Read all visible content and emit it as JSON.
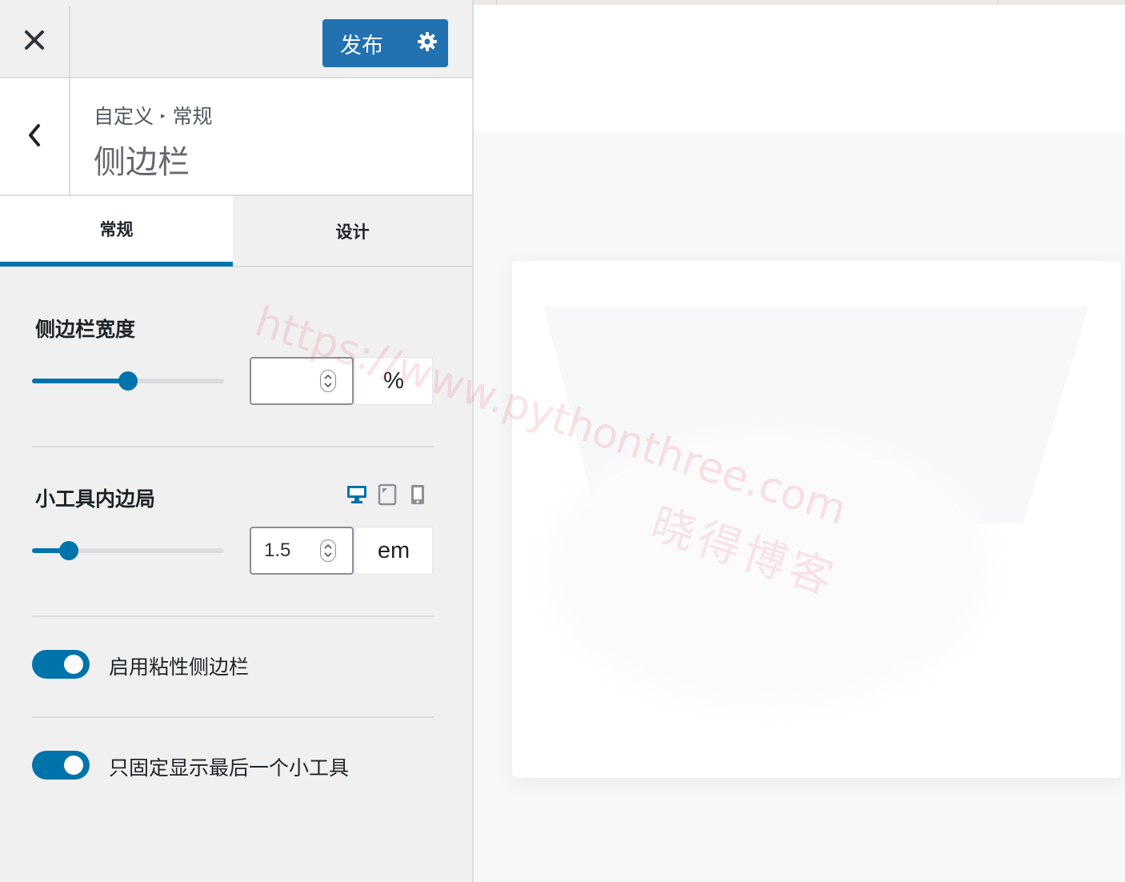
{
  "topbar": {
    "close_icon": "close-icon",
    "publish_label": "发布",
    "publish_settings_icon": "gear-icon",
    "publish_color": "#2271b1"
  },
  "header": {
    "back_icon": "chevron-left-icon",
    "breadcrumb": [
      "自定义",
      "常规"
    ],
    "breadcrumb_separator": "▸",
    "title": "侧边栏"
  },
  "tabs": [
    {
      "label": "常规",
      "active": true
    },
    {
      "label": "设计",
      "active": false
    }
  ],
  "controls": {
    "sidebar_width": {
      "label": "侧边栏宽度",
      "slider_percent": 50,
      "input_value": "",
      "unit": "%"
    },
    "widget_padding": {
      "label": "小工具内边局",
      "devices": [
        "desktop-icon",
        "tablet-icon",
        "mobile-icon"
      ],
      "active_device": "desktop-icon",
      "slider_percent": 19,
      "input_value": "1.5",
      "unit": "em"
    },
    "sticky_sidebar": {
      "label": "启用粘性侧边栏",
      "enabled": true
    },
    "sticky_last_widget": {
      "label": "只固定显示最后一个小工具",
      "enabled": true
    }
  },
  "accent_color": "#0073aa",
  "watermark": {
    "url": "https://www.pythonthree.com",
    "name": "晓得博客"
  }
}
